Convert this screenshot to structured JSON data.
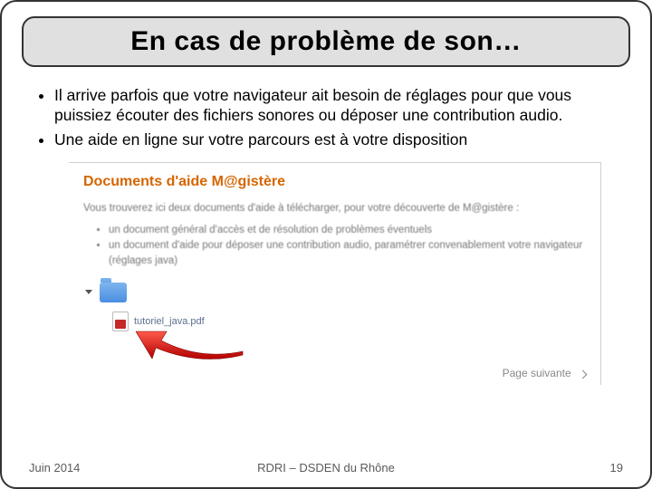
{
  "title": "En cas de problème de son…",
  "bullets": {
    "b1": "Il arrive parfois que votre navigateur ait besoin de réglages pour que vous puissiez écouter des fichiers sonores ou déposer une contribution audio.",
    "b2": "Une aide en ligne sur votre parcours est à votre disposition"
  },
  "embed": {
    "heading": "Documents d'aide M@gistère",
    "intro": "Vous trouverez ici deux documents d'aide à télécharger, pour votre découverte de M@gistère :",
    "items": {
      "i1": "un document général d'accès et de résolution de problèmes éventuels",
      "i2": "un document d'aide pour déposer une contribution audio, paramétrer convenablement votre navigateur (réglages java)"
    },
    "pdf_name": "tutoriel_java.pdf",
    "next_label": "Page suivante"
  },
  "footer": {
    "date": "Juin 2014",
    "org": "RDRI – DSDEN du Rhône",
    "page": "19"
  }
}
